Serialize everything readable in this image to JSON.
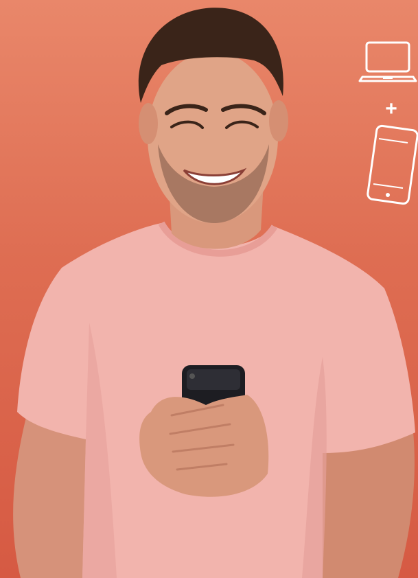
{
  "scene": {
    "background_colors": [
      "#e9876a",
      "#de6d52",
      "#d65a43"
    ],
    "subject": {
      "shirt_color": "#f2b4ad",
      "skin_color": "#d9987c",
      "hair_color": "#3a2419",
      "phone_color": "#1d1d22"
    }
  },
  "icons": {
    "laptop": "laptop-icon",
    "plus": "+",
    "phone": "smartphone-icon",
    "color": "#ffffff"
  }
}
